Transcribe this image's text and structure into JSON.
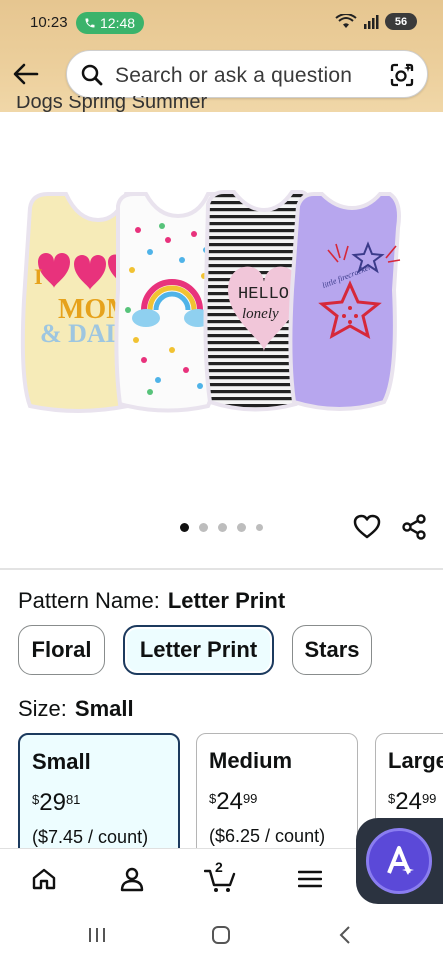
{
  "status_bar": {
    "time": "10:23",
    "call_time": "12:48",
    "battery": "56"
  },
  "search": {
    "placeholder": "Search or ask a question"
  },
  "product": {
    "title_cut": "Dogs Spring Summer",
    "image_items": [
      {
        "design": "I love my MOM & DAD",
        "color": "#f6ebb8"
      },
      {
        "design": "rainbow polka dots",
        "color": "#fbfbfb"
      },
      {
        "design": "HELLO lonely",
        "color": "#e8e8ec"
      },
      {
        "design": "little firecracker",
        "color": "#b7a6ee"
      }
    ],
    "image_texts": {
      "mom": "MOM",
      "dad": "& DAD",
      "hello": "HELLO",
      "lonely": "lonely",
      "firecracker": "little firecracker"
    },
    "carousel_count": 5,
    "carousel_active": 1
  },
  "pattern": {
    "label": "Pattern Name:",
    "selected": "Letter Print",
    "options": [
      "Floral",
      "Letter Print",
      "Stars"
    ]
  },
  "size": {
    "label": "Size:",
    "selected": "Small",
    "options": [
      {
        "name": "Small",
        "currency": "$",
        "dollars": "29",
        "cents": "81",
        "unit": "($7.45 / count)"
      },
      {
        "name": "Medium",
        "currency": "$",
        "dollars": "24",
        "cents": "99",
        "unit": "($6.25 / count)"
      },
      {
        "name": "Large",
        "currency": "$",
        "dollars": "24",
        "cents": "99",
        "unit": ""
      }
    ]
  },
  "bottom_nav": {
    "items": [
      "home-icon",
      "profile-icon",
      "cart-icon",
      "menu-icon"
    ],
    "cart_count": "2"
  },
  "colors": {
    "header_bg": "#e6c690",
    "selected_border": "#1c3a5e",
    "selected_bg": "#edfdff",
    "fab": "#5b49d8"
  }
}
